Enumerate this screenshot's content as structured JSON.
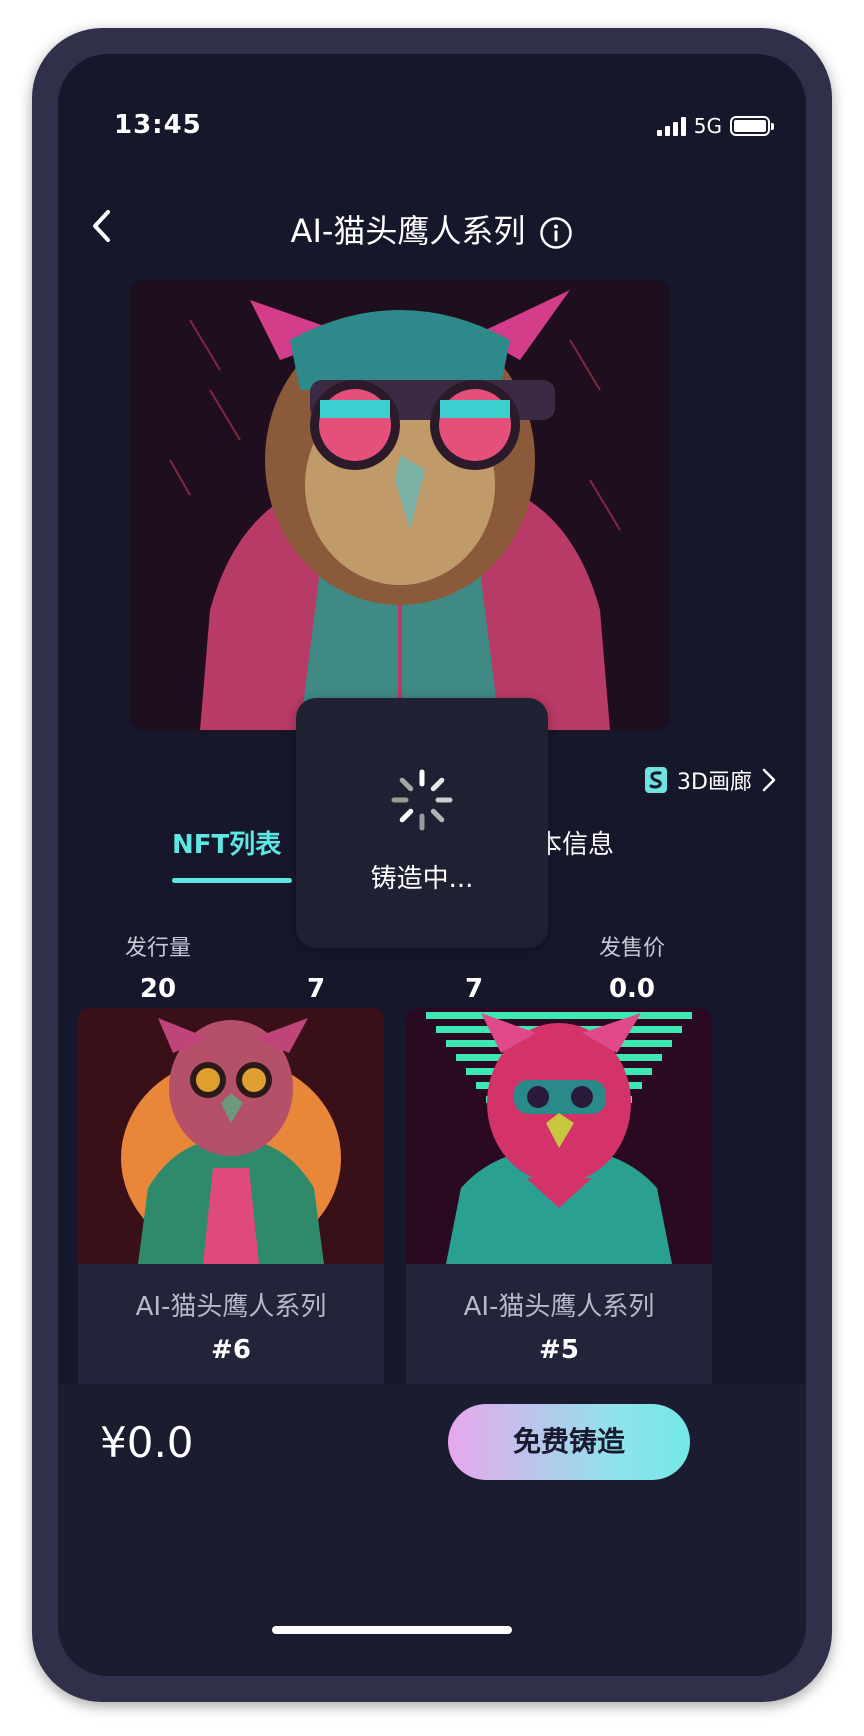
{
  "status_bar": {
    "time": "13:45",
    "network": "5G"
  },
  "nav": {
    "title": "AI-猫头鹰人系列"
  },
  "gallery_link": {
    "label": "3D画廊"
  },
  "tabs": [
    {
      "label": "NFT列表",
      "active": true
    },
    {
      "label": "基本信息",
      "active": false
    }
  ],
  "stats": [
    {
      "label": "发行量",
      "value": "20"
    },
    {
      "label": "",
      "value": "7"
    },
    {
      "label": "",
      "value": "7"
    },
    {
      "label": "发售价",
      "value": "0.0"
    }
  ],
  "cards": [
    {
      "title": "AI-猫头鹰人系列",
      "number": "#6"
    },
    {
      "title": "AI-猫头鹰人系列",
      "number": "#5"
    }
  ],
  "bottom_bar": {
    "price": "¥0.0",
    "mint_label": "免费铸造"
  },
  "toast": {
    "text": "铸造中..."
  },
  "colors": {
    "accent": "#5ee8e4",
    "background": "#17172b",
    "device_frame": "#30304a",
    "button_gradient_start": "#e7a7ed",
    "button_gradient_end": "#73e8e6"
  }
}
